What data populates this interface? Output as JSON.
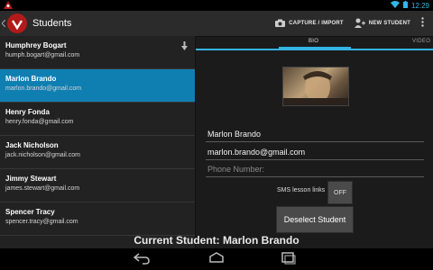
{
  "status_bar": {
    "time": "12:29"
  },
  "action_bar": {
    "title": "Students",
    "capture_label": "CAPTURE / IMPORT",
    "new_student_label": "NEW STUDENT"
  },
  "students": [
    {
      "name": "Humphrey Bogart",
      "email": "humph.bogart@gmail.com"
    },
    {
      "name": "Marlon Brando",
      "email": "marlon.brando@gmail.com"
    },
    {
      "name": "Henry Fonda",
      "email": "henry.fonda@gmail.com"
    },
    {
      "name": "Jack Nicholson",
      "email": "jack.nicholson@gmail.com"
    },
    {
      "name": "Jimmy Stewart",
      "email": "james.stewart@gmail.com"
    },
    {
      "name": "Spencer Tracy",
      "email": "spencer.tracy@gmail.com"
    }
  ],
  "tabs": {
    "bio": "BIO",
    "video": "VIDEO"
  },
  "detail": {
    "name_value": "Marlon Brando",
    "email_value": "marlon.brando@gmail.com",
    "phone_placeholder": "Phone Number:",
    "sms_label": "SMS lesson links",
    "sms_toggle": "OFF",
    "deselect_label": "Deselect Student"
  },
  "current_student": "Current Student: Marlon Brando",
  "colors": {
    "accent": "#33b5e5",
    "selected_row": "#0f7fb1",
    "brand_red": "#b21a1a"
  }
}
